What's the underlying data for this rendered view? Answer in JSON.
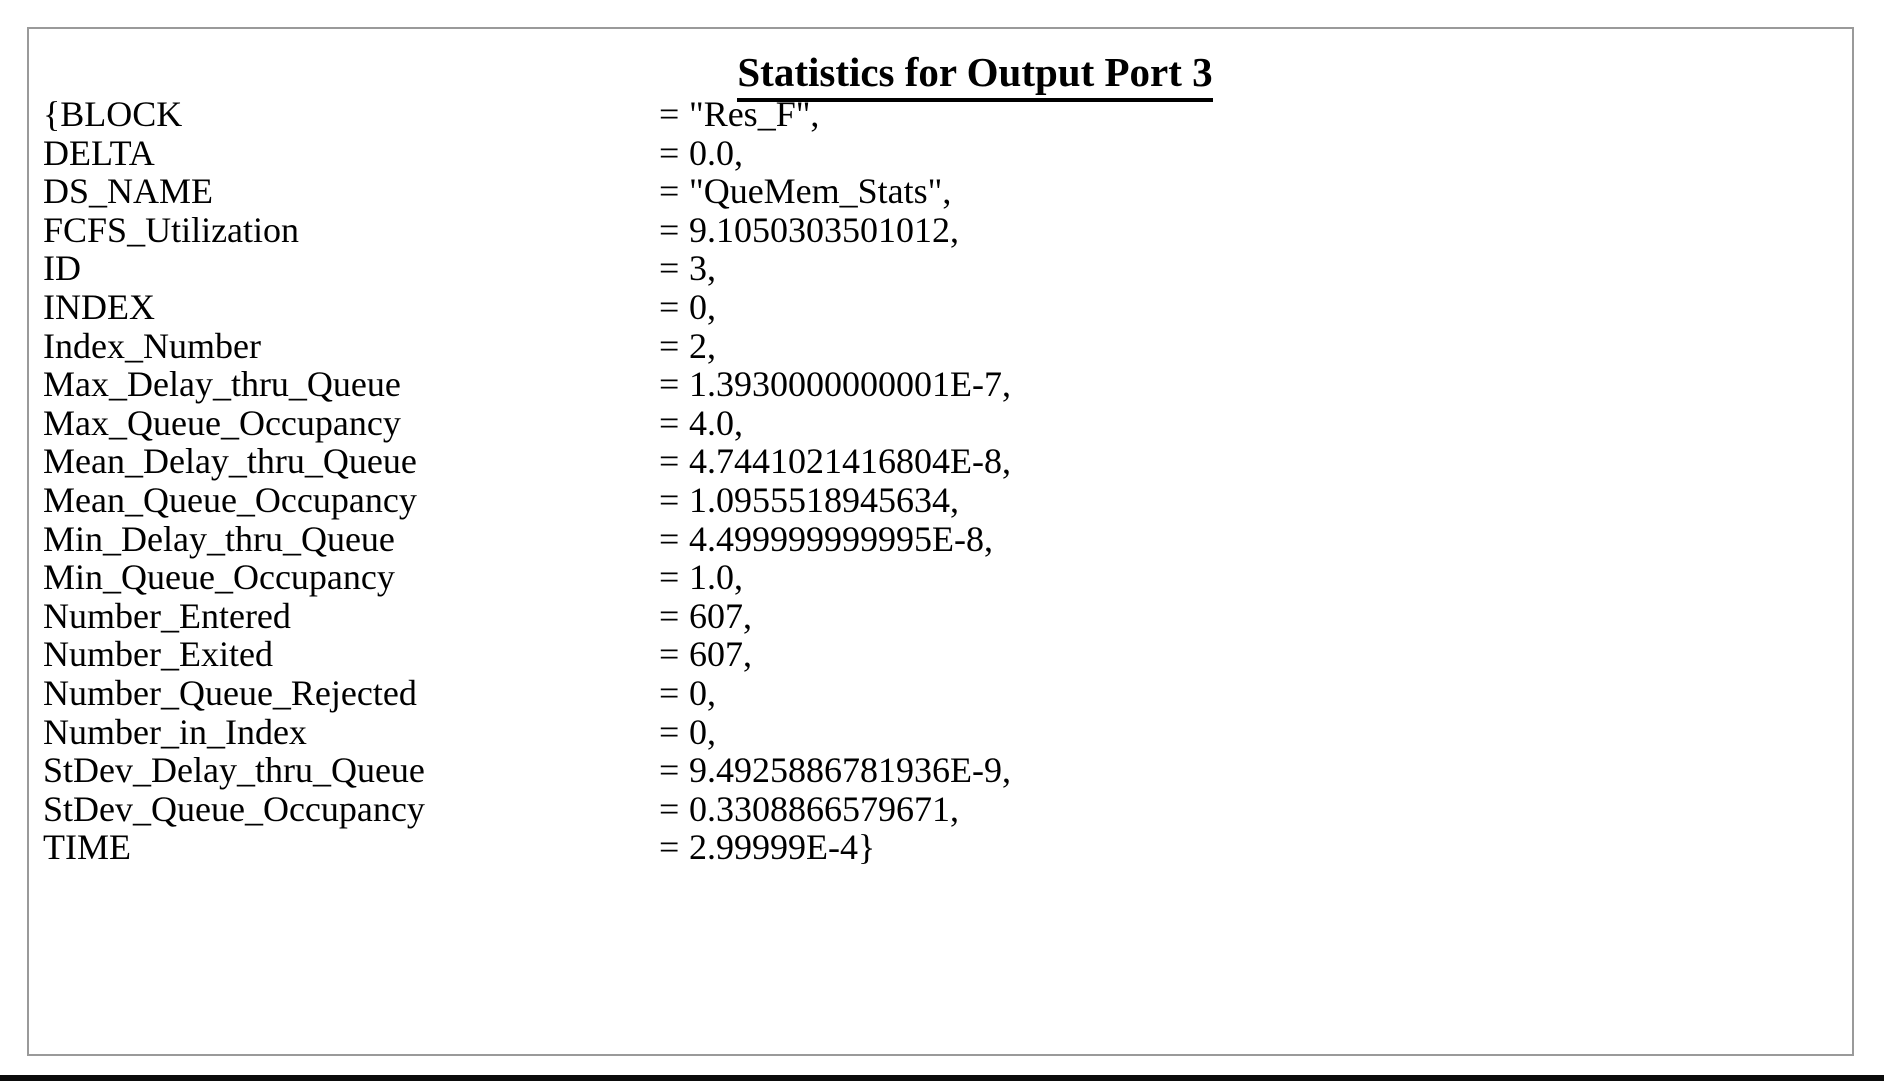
{
  "panel": {
    "title": "Statistics for Output Port 3",
    "equals_sign": "=",
    "border_color": "#9a9a9a",
    "text_color": "#000000",
    "background_color": "#ffffff"
  },
  "stats": {
    "rows": [
      {
        "key": "{BLOCK",
        "value": "\"Res_F\","
      },
      {
        "key": "DELTA",
        "value": "0.0,"
      },
      {
        "key": "DS_NAME",
        "value": "\"QueMem_Stats\","
      },
      {
        "key": "FCFS_Utilization",
        "value": "9.1050303501012,"
      },
      {
        "key": "ID",
        "value": "3,"
      },
      {
        "key": "INDEX",
        "value": "0,"
      },
      {
        "key": "Index_Number",
        "value": "2,"
      },
      {
        "key": "Max_Delay_thru_Queue",
        "value": "1.3930000000001E-7,"
      },
      {
        "key": "Max_Queue_Occupancy",
        "value": "4.0,"
      },
      {
        "key": "Mean_Delay_thru_Queue",
        "value": "4.7441021416804E-8,"
      },
      {
        "key": "Mean_Queue_Occupancy",
        "value": "1.0955518945634,"
      },
      {
        "key": "Min_Delay_thru_Queue",
        "value": "4.499999999995E-8,"
      },
      {
        "key": "Min_Queue_Occupancy",
        "value": "1.0,"
      },
      {
        "key": "Number_Entered",
        "value": "607,"
      },
      {
        "key": "Number_Exited",
        "value": "607,"
      },
      {
        "key": "Number_Queue_Rejected",
        "value": "0,"
      },
      {
        "key": "Number_in_Index",
        "value": "0,"
      },
      {
        "key": "StDev_Delay_thru_Queue",
        "value": "9.4925886781936E-9,"
      },
      {
        "key": "StDev_Queue_Occupancy",
        "value": "0.3308866579671,"
      },
      {
        "key": "TIME",
        "value": "2.99999E-4}"
      }
    ]
  }
}
